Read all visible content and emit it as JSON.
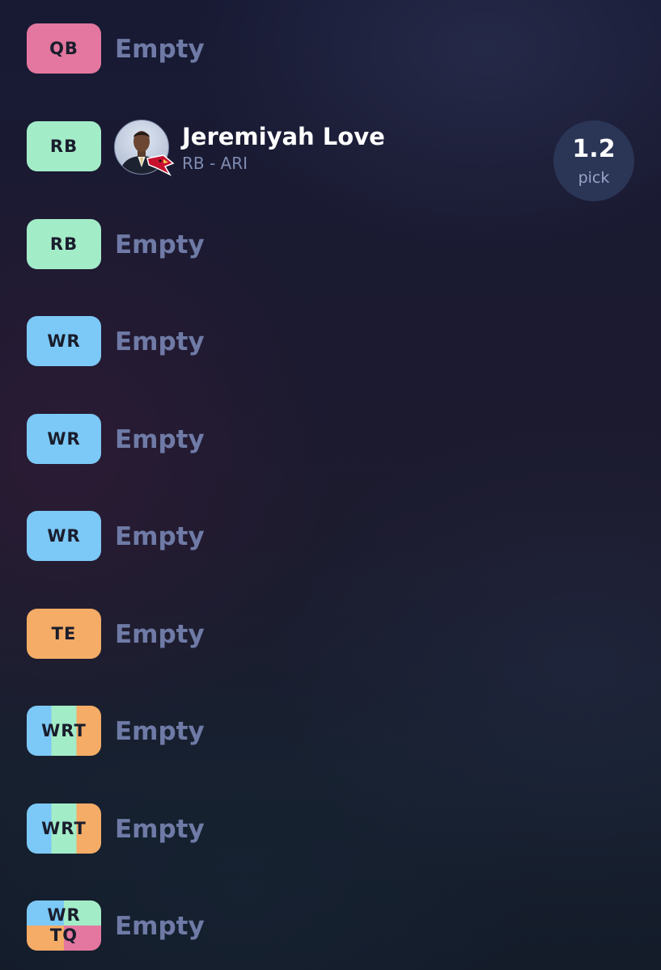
{
  "roster": {
    "slots": [
      {
        "position": "QB",
        "type": "qb",
        "label": "Empty"
      },
      {
        "position": "RB",
        "type": "rb",
        "player": {
          "name": "Jeremiyah Love",
          "meta": "RB - ARI",
          "avatar_icon": "player-headshot",
          "team_icon": "cardinals-logo",
          "pick_number": "1.2",
          "pick_label": "pick"
        }
      },
      {
        "position": "RB",
        "type": "rb",
        "label": "Empty"
      },
      {
        "position": "WR",
        "type": "wr",
        "label": "Empty"
      },
      {
        "position": "WR",
        "type": "wr",
        "label": "Empty"
      },
      {
        "position": "WR",
        "type": "wr",
        "label": "Empty"
      },
      {
        "position": "TE",
        "type": "te",
        "label": "Empty"
      },
      {
        "position": "WRT",
        "type": "flex",
        "label": "Empty"
      },
      {
        "position": "WRT",
        "type": "flex",
        "label": "Empty"
      },
      {
        "position_line1": "WR",
        "position_line2": "TQ",
        "type": "superflex",
        "label": "Empty"
      }
    ]
  },
  "colors": {
    "qb": "#e3779f",
    "rb": "#a3ecc8",
    "wr": "#7cc8f6",
    "te": "#f4ac66",
    "empty_text": "#6f7ba6",
    "pick_circle": "#2b3556"
  }
}
